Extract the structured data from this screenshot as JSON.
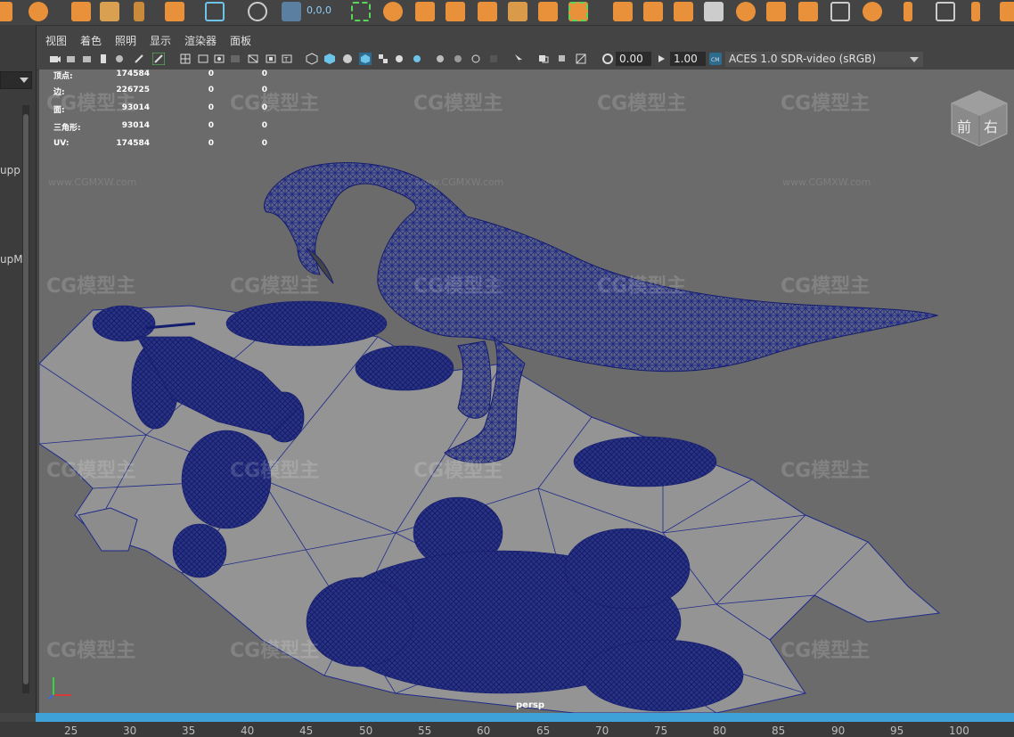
{
  "menu": [
    "视图",
    "着色",
    "照明",
    "显示",
    "渲染器",
    "面板"
  ],
  "left_panel": {
    "label1": "upp",
    "label2": "upM"
  },
  "toolbar": {
    "exposure": "0.00",
    "gamma": "1.00",
    "color_space": "ACES 1.0 SDR-video (sRGB)"
  },
  "hud": [
    {
      "key": "顶点:",
      "v1": "174584",
      "v2": "0",
      "v3": "0"
    },
    {
      "key": "边:",
      "v1": "226725",
      "v2": "0",
      "v3": "0"
    },
    {
      "key": "面:",
      "v1": "93014",
      "v2": "0",
      "v3": "0"
    },
    {
      "key": "三角形:",
      "v1": "93014",
      "v2": "0",
      "v3": "0"
    },
    {
      "key": "UV:",
      "v1": "174584",
      "v2": "0",
      "v3": "0"
    }
  ],
  "viewcube": {
    "front": "前",
    "right": "右"
  },
  "camera_label": "persp",
  "shelf_value": "0,0,0",
  "timeline": [
    "25",
    "30",
    "35",
    "40",
    "45",
    "50",
    "55",
    "60",
    "65",
    "70",
    "75",
    "80",
    "85",
    "90",
    "95",
    "100"
  ],
  "watermark": {
    "logo": "CG模型主",
    "url": "www.CGMXW.com"
  },
  "colors": {
    "viewport_bg": "#6b6b6b",
    "wireframe": "#1f2a8a",
    "accent": "#3ea2d8",
    "shelf_orange": "#e8913a"
  }
}
